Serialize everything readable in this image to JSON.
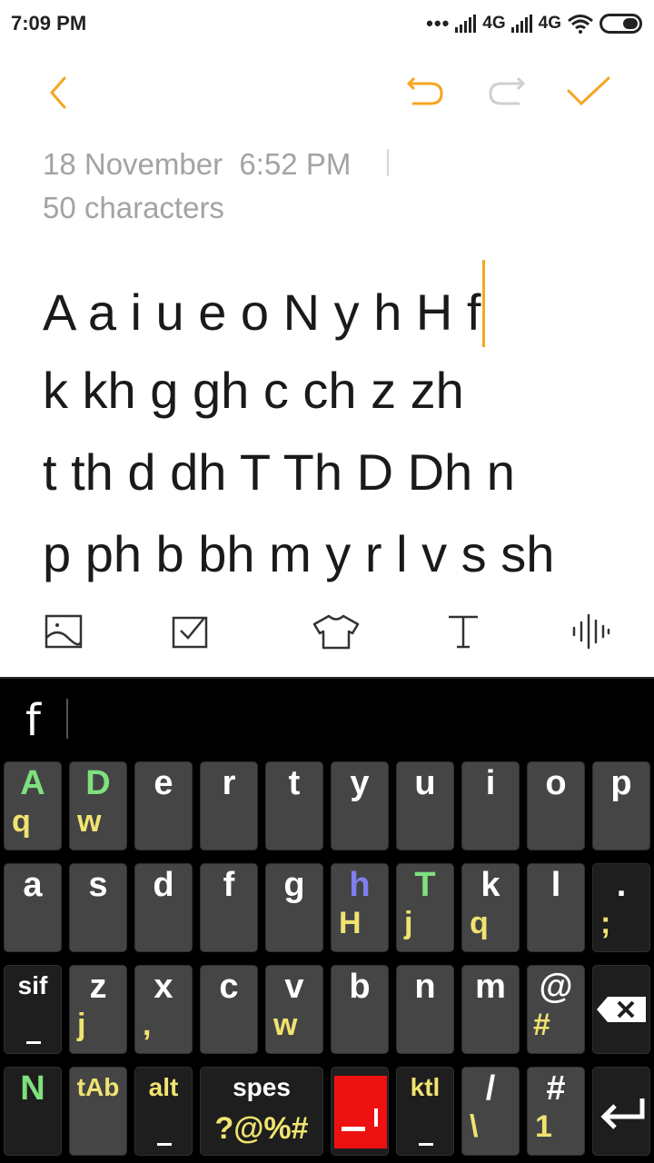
{
  "status_bar": {
    "time": "7:09 PM",
    "dots": "•••",
    "network1": "4G",
    "network2": "4G"
  },
  "note": {
    "date": "18 November  6:52 PM",
    "char_count": "50 characters",
    "lines": [
      "A a i u e o N y h H f",
      "k kh g gh c ch z zh",
      "t th d dh T Th D Dh n",
      "p ph b bh m y r l v s sh"
    ]
  },
  "colors": {
    "accent": "#f5a623",
    "green_label": "#7ee07e",
    "yellow_label": "#f0e370",
    "blue_label": "#7f7ff0",
    "key_bg": "#454545"
  },
  "keyboard": {
    "composing": "f",
    "row1": [
      {
        "pri": "A",
        "sec": "q",
        "pri_color": "green"
      },
      {
        "pri": "D",
        "sec": "w",
        "pri_color": "green"
      },
      {
        "pri": "e",
        "sec": ""
      },
      {
        "pri": "r",
        "sec": ""
      },
      {
        "pri": "t",
        "sec": ""
      },
      {
        "pri": "y",
        "sec": ""
      },
      {
        "pri": "u",
        "sec": ""
      },
      {
        "pri": "i",
        "sec": ""
      },
      {
        "pri": "o",
        "sec": ""
      },
      {
        "pri": "p",
        "sec": ""
      }
    ],
    "row2": [
      {
        "pri": "a",
        "sec": ""
      },
      {
        "pri": "s",
        "sec": ""
      },
      {
        "pri": "d",
        "sec": ""
      },
      {
        "pri": "f",
        "sec": ""
      },
      {
        "pri": "g",
        "sec": ""
      },
      {
        "pri": "h",
        "sec": "H",
        "pri_color": "blue"
      },
      {
        "pri": "T",
        "sec": "j",
        "pri_color": "green"
      },
      {
        "pri": "k",
        "sec": "q"
      },
      {
        "pri": "l",
        "sec": ""
      },
      {
        "pri": ".",
        "sec": ";"
      }
    ],
    "row3": [
      {
        "pri": "sif",
        "sec": ""
      },
      {
        "pri": "z",
        "sec": "j"
      },
      {
        "pri": "x",
        "sec": ","
      },
      {
        "pri": "c",
        "sec": ""
      },
      {
        "pri": "v",
        "sec": "w"
      },
      {
        "pri": "b",
        "sec": ""
      },
      {
        "pri": "n",
        "sec": ""
      },
      {
        "pri": "m",
        "sec": ""
      },
      {
        "pri": "@",
        "sec": "#"
      }
    ],
    "row4": {
      "n": "N",
      "tab": "tAb",
      "alt": "alt",
      "space": "spes",
      "space_sec": "?@%#",
      "ktl": "ktl",
      "slash": "/",
      "slash_sec": "\\",
      "hash": "#",
      "hash_sec": "1"
    }
  }
}
